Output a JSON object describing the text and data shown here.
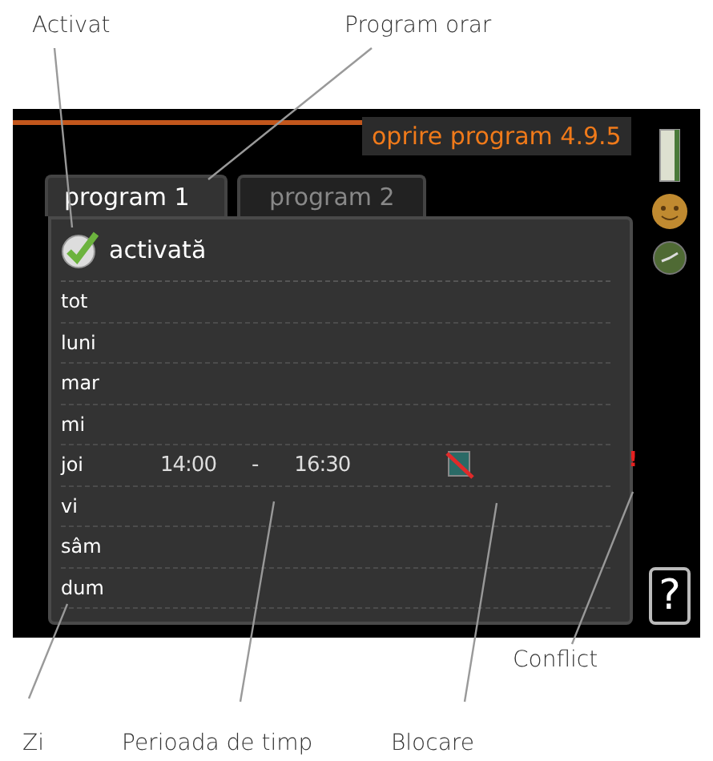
{
  "callouts_top": [
    "Activat",
    "Program orar"
  ],
  "screen": {
    "title": "oprire program 4.9.5",
    "tabs": [
      {
        "label": "program 1",
        "selected": true
      },
      {
        "label": "program 2",
        "selected": false
      }
    ],
    "activated": {
      "label": "activată",
      "checked": true
    },
    "days": [
      {
        "day": "tot"
      },
      {
        "day": "luni"
      },
      {
        "day": "mar"
      },
      {
        "day": "mi"
      },
      {
        "day": "joi",
        "start": "14:00",
        "separator": "-",
        "end": "16:30",
        "blocked": true,
        "conflict": "!"
      },
      {
        "day": "vi"
      },
      {
        "day": "sâm"
      },
      {
        "day": "dum"
      }
    ],
    "help": "?"
  },
  "callout_right": "Conflict",
  "callouts_bottom": [
    "Zi",
    "Perioada de timp",
    "Blocare"
  ]
}
